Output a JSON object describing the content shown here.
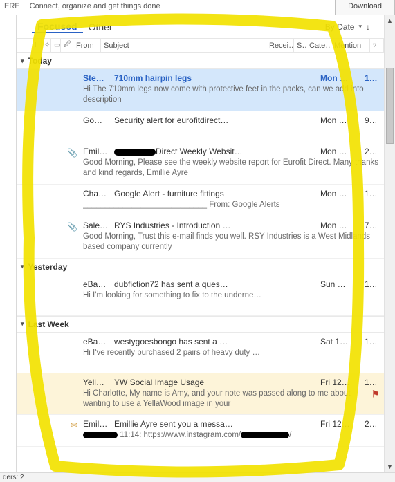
{
  "ribbon": {
    "left_tag": "ERE",
    "motto": "Connect, organize and get things done",
    "download": "Download"
  },
  "tabs": {
    "focused": "Focused",
    "other": "Other"
  },
  "sort": {
    "label": "By Date",
    "chevron": "▾",
    "arrow": "↓"
  },
  "columns": {
    "flag_icon": "!",
    "bell_icon": "🔔",
    "pin_icon": "📎",
    "att_icon": "📎",
    "from": "From",
    "subject": "Subject",
    "received": "Recei…",
    "size": "S…",
    "categories": "Cate…",
    "mentions": "Mention",
    "flag2_icon": "⚑"
  },
  "groups": [
    {
      "name": "today",
      "label": "Today",
      "items": [
        {
          "id": "m1",
          "unread": true,
          "selected": true,
          "icon": "",
          "from": "Ste…",
          "subject": "710mm hairpin legs",
          "date": "Mon …",
          "count": "1…",
          "preview": "Hi  The 710mm legs now come with protective feet in the packs, can we add into description",
          "single": false
        },
        {
          "id": "m2",
          "unread": false,
          "icon": "",
          "from": "Go…",
          "subject": "Security alert for eurofitdirect…",
          "date": "Mon …",
          "count": "9…",
          "preview": "<https://www.gstatic.com/accountalerts/email/Icon_recovery_>",
          "single": true,
          "gap": true
        },
        {
          "id": "m3",
          "unread": false,
          "icon": "attach",
          "from": "Emil…",
          "subject_pre": "",
          "subject_redact": 60,
          "subject_post": "Direct Weekly Websit…",
          "date": "Mon …",
          "count": "2…",
          "preview": "Good Morning,  Please see the weekly website report for Eurofit Direct.    Many thanks and kind regards,   Emillie Ayre",
          "single": false
        },
        {
          "id": "m4",
          "unread": false,
          "icon": "",
          "from": "Cha…",
          "subject": "Google Alert - furniture fittings",
          "date": "Mon …",
          "count": "1…",
          "preview": "____________________________\nFrom: Google Alerts",
          "single": false
        },
        {
          "id": "m5",
          "unread": false,
          "icon": "attach",
          "from": "Sale…",
          "subject": "RYS Industries - Introduction …",
          "date": "Mon …",
          "count": "7…",
          "preview": "Good Morning,  Trust this e-mail finds you well.    RSY Industries is a West Midlands based company currently",
          "single": false
        }
      ]
    },
    {
      "name": "yesterday",
      "label": "Yesterday",
      "items": [
        {
          "id": "m6",
          "unread": false,
          "icon": "",
          "from": "eBa…",
          "subject": "dubfiction72 has sent a ques…",
          "date": "Sun …",
          "count": "1…",
          "preview": "Hi I'm looking for something to fix to the underne…",
          "single": true,
          "gap_after": true
        }
      ]
    },
    {
      "name": "lastweek",
      "label": "Last Week",
      "items": [
        {
          "id": "m7",
          "unread": false,
          "icon": "",
          "from": "eBa…",
          "subject": "westygoesbongo has sent a …",
          "date": "Sat 1…",
          "count": "1…",
          "preview": "Hi I've recently purchased 2 pairs of heavy duty …",
          "single": true,
          "gap_after": true
        },
        {
          "id": "m8",
          "unread": false,
          "flagged": true,
          "icon": "",
          "from": "Yell…",
          "subject": "YW Social Image Usage",
          "date": "Fri 12…",
          "count": "1…",
          "preview": "Hi Charlotte,  My name is Amy, and your note was passed along to me about wanting to use a YellaWood image in your",
          "single": false
        },
        {
          "id": "m9",
          "unread": false,
          "icon": "envelope",
          "from": "Emil…",
          "subject": "Emillie Ayre sent you a messa…",
          "date": "Fri 12…",
          "count": "2…",
          "preview_parts": {
            "p1": "",
            "redact1": 50,
            "p2": " 11:14:  https://www.instagram.com/",
            "redact2": 70,
            "p3": "/"
          },
          "single": false
        }
      ]
    }
  ],
  "status": {
    "text": "ders: 2"
  },
  "scrollbar": {
    "up": "▲",
    "down": "▼"
  }
}
